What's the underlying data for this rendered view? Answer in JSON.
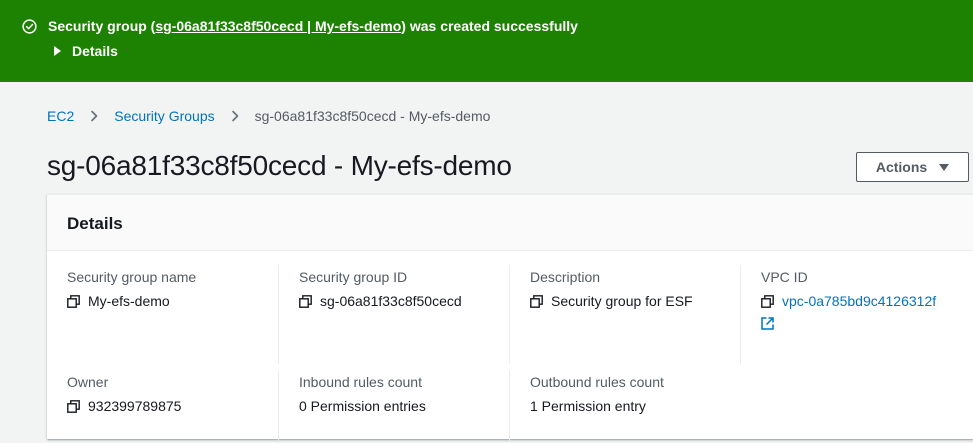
{
  "flash": {
    "prefix": "Security group (",
    "link_text": "sg-06a81f33c8f50cecd | My-efs-demo",
    "suffix": ") was created successfully",
    "details_toggle": "Details",
    "color": "#1d8102"
  },
  "breadcrumb": {
    "items": [
      "EC2",
      "Security Groups",
      "sg-06a81f33c8f50cecd - My-efs-demo"
    ]
  },
  "page_title": "sg-06a81f33c8f50cecd - My-efs-demo",
  "actions_button": "Actions",
  "details_panel": {
    "title": "Details",
    "fields": [
      {
        "label": "Security group name",
        "value": "My-efs-demo"
      },
      {
        "label": "Security group ID",
        "value": "sg-06a81f33c8f50cecd"
      },
      {
        "label": "Description",
        "value": "Security group for ESF"
      },
      {
        "label": "VPC ID",
        "value": "vpc-0a785bd9c4126312f"
      },
      {
        "label": "Owner",
        "value": "932399789875"
      },
      {
        "label": "Inbound rules count",
        "value": "0 Permission entries"
      },
      {
        "label": "Outbound rules count",
        "value": "1 Permission entry"
      }
    ]
  },
  "icons": {
    "flash": "check-circle-icon",
    "toggle": "caret-right-icon",
    "breadcrumb_separator": "chevron-right-icon",
    "actions": "caret-down-icon",
    "copy": "copy-icon",
    "external": "external-link-icon"
  }
}
